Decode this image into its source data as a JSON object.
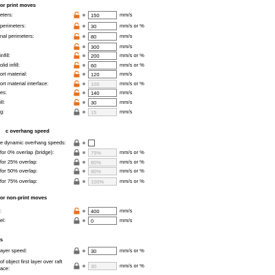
{
  "print_moves": {
    "title": "or print moves",
    "rows": [
      {
        "label": "eters:",
        "value": "150",
        "unit": "mm/s",
        "lock": "orange",
        "disabled": false
      },
      {
        "label": "perimeters:",
        "value": "30",
        "unit": "mm/s or %",
        "lock": "orange",
        "disabled": false
      },
      {
        "label": "nal perimeters:",
        "value": "80",
        "unit": "mm/s",
        "lock": "orange",
        "disabled": false
      },
      {
        "label": "",
        "value": "300",
        "unit": "mm/s",
        "lock": "orange",
        "disabled": false
      },
      {
        "label": "infill:",
        "value": "200",
        "unit": "mm/s or %",
        "lock": "orange",
        "disabled": false
      },
      {
        "label": "olid infill:",
        "value": "60",
        "unit": "mm/s or %",
        "lock": "orange",
        "disabled": false
      },
      {
        "label": "ort material:",
        "value": "120",
        "unit": "mm/s",
        "lock": "orange",
        "disabled": false
      },
      {
        "label": "ort material interface:",
        "value": "100",
        "unit": "mm/s or %",
        "lock": "orange",
        "disabled": true
      },
      {
        "label": "es:",
        "value": "140",
        "unit": "mm/s",
        "lock": "orange",
        "disabled": false
      },
      {
        "label": "ill:",
        "value": "30",
        "unit": "mm/s",
        "lock": "orange",
        "disabled": false
      },
      {
        "label": "g:",
        "value": "15",
        "unit": "mm/s",
        "lock": "gray",
        "disabled": true
      }
    ]
  },
  "overhang": {
    "title": "c overhang speed",
    "enable_label": "e dynamic overhang speeds:",
    "rows": [
      {
        "label": "for 0% overlap (bridge):",
        "value": "75%",
        "unit": "mm/s or %",
        "lock": "gray",
        "disabled": true
      },
      {
        "label": "for 25% overlap:",
        "value": "80%",
        "unit": "mm/s or %",
        "lock": "gray",
        "disabled": true
      },
      {
        "label": "for 50% overlap:",
        "value": "90%",
        "unit": "mm/s or %",
        "lock": "gray",
        "disabled": true
      },
      {
        "label": "for 75% overlap:",
        "value": "100%",
        "unit": "mm/s or %",
        "lock": "gray",
        "disabled": true
      }
    ]
  },
  "non_print": {
    "title": "or non-print moves",
    "rows": [
      {
        "label": ":",
        "value": "400",
        "unit": "mm/s",
        "lock": "orange",
        "disabled": false
      },
      {
        "label": "el:",
        "value": "0",
        "unit": "mm/s",
        "lock": "gray",
        "disabled": false
      }
    ]
  },
  "first_layer": {
    "title": "s",
    "rows": [
      {
        "label": "ayer speed:",
        "value": "30",
        "unit": "mm/s or %",
        "lock": "gray",
        "disabled": false
      },
      {
        "label": "of object first layer over raft",
        "label2": "ace:",
        "value": "30",
        "unit": "mm/s or %",
        "lock": "gray",
        "disabled": true
      }
    ]
  },
  "colors": {
    "lock_orange": "#e8701a",
    "lock_gray": "#6e6e6e",
    "dot": "#8f8f8f"
  }
}
